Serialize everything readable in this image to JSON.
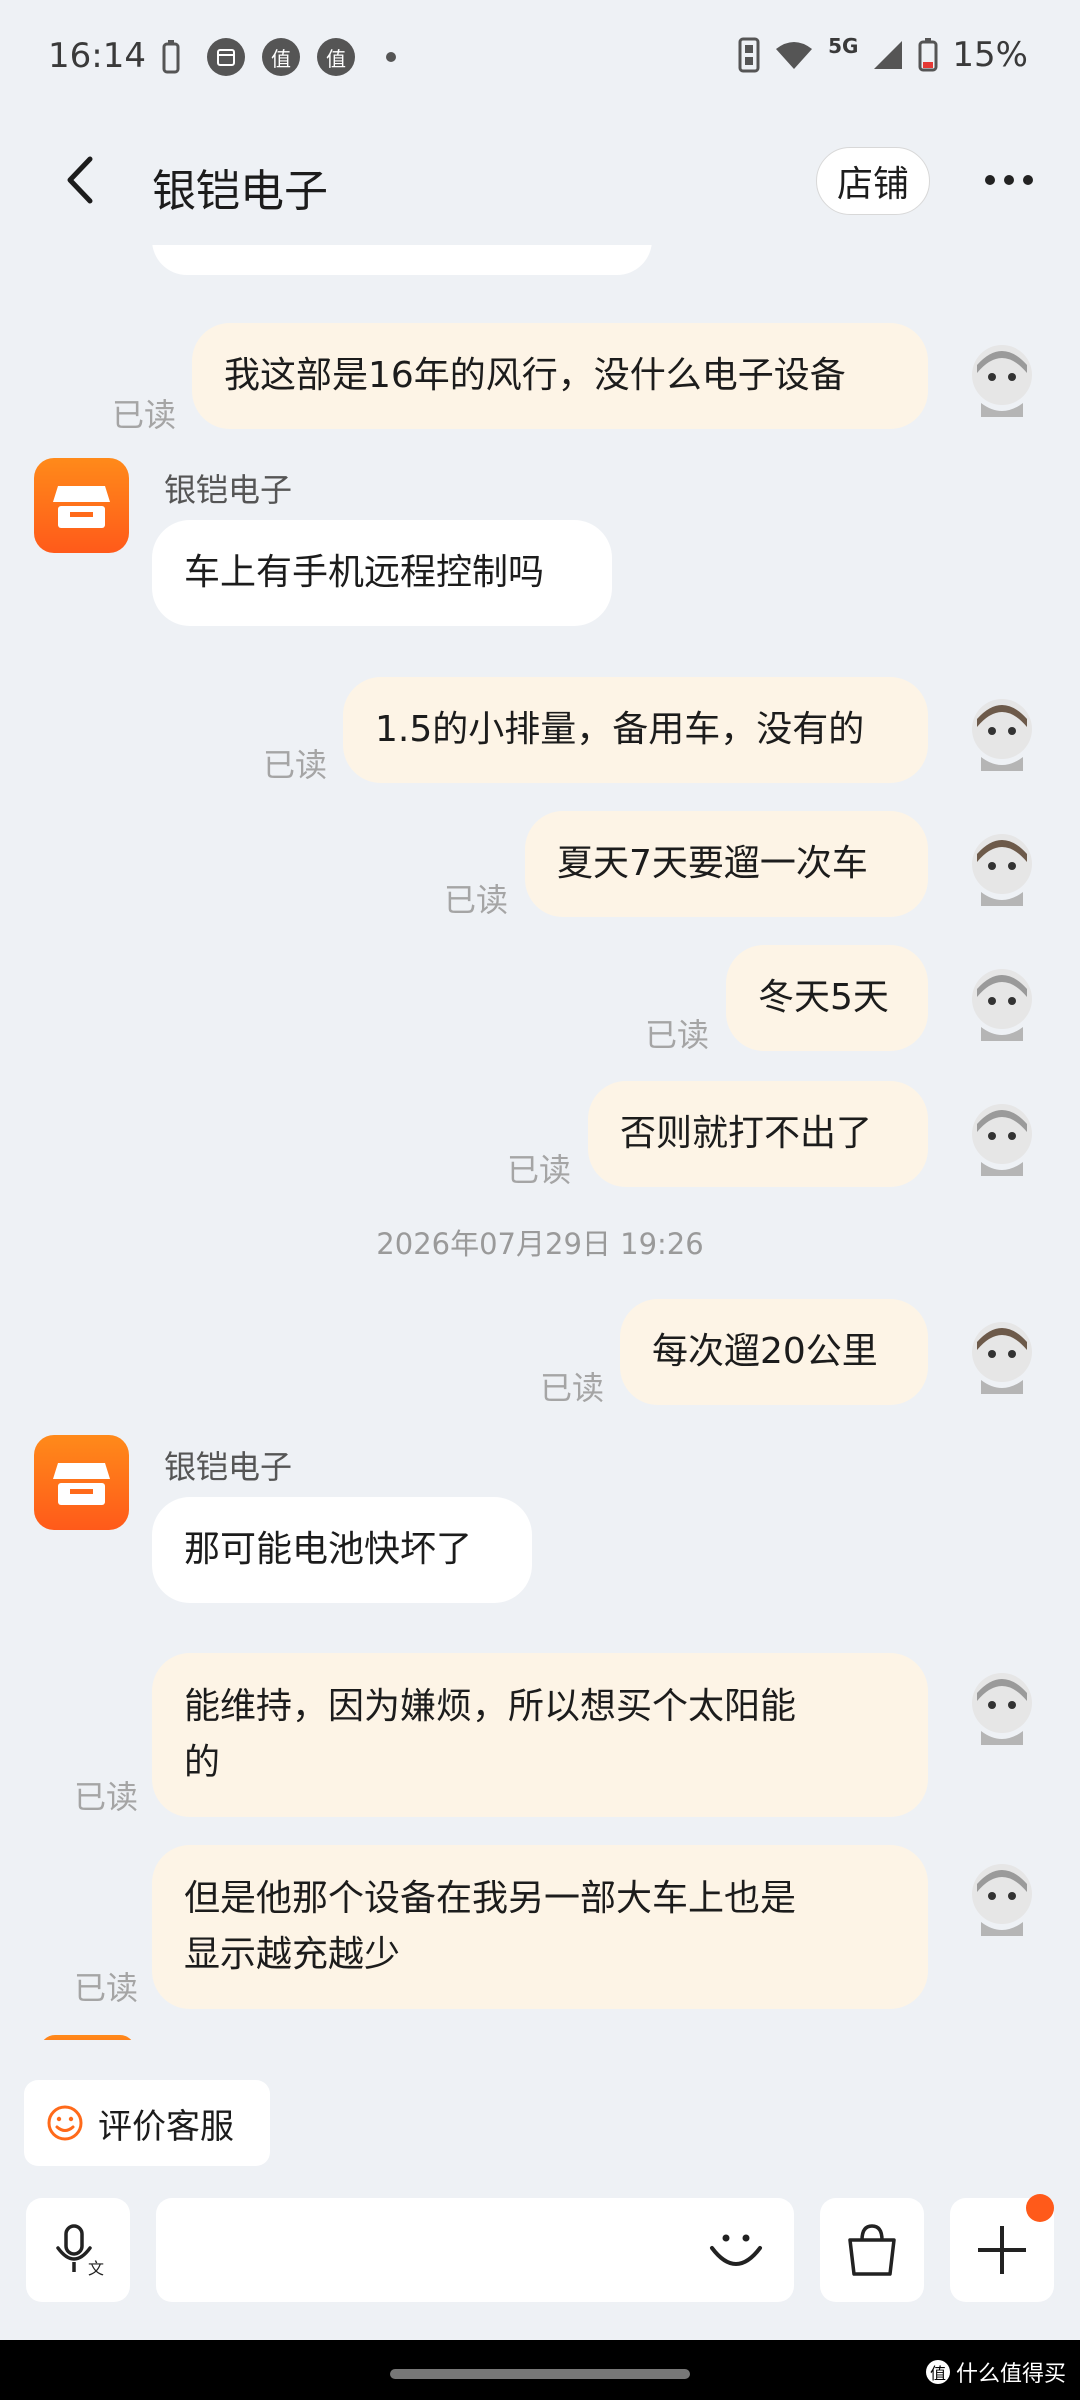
{
  "status": {
    "time": "16:14",
    "network": "5G",
    "battery": "15%",
    "icons": [
      "battery-saver-icon",
      "calendar-icon",
      "zhi-app-icon",
      "zhi-app-icon",
      "dot-icon"
    ]
  },
  "header": {
    "title": "银铠电子",
    "shop_label": "店铺"
  },
  "messages": {
    "m1": "我这部是16年的风行，没什么电子设备",
    "sender1": "银铠电子",
    "m2": "车上有手机远程控制吗",
    "m3": "1.5的小排量，备用车，没有的",
    "m4": "夏天7天要遛一次车",
    "m5": "冬天5天",
    "m6": "否则就打不出了",
    "timestamp": "2026年07月29日 19:26",
    "m7": "每次遛20公里",
    "sender2": "银铠电子",
    "m8": "那可能电池快坏了",
    "m9_line1": "能维持，因为嫌烦，所以想买个太阳能",
    "m9_line2": "的",
    "m10_line1": "但是他那个设备在我另一部大车上也是",
    "m10_line2": "显示越充越少",
    "read": "已读"
  },
  "footer": {
    "eval_label": "评价客服",
    "watermark": "什么值得买"
  },
  "colors": {
    "accent": "#ff6a1a",
    "out_bubble": "#fdf4e6",
    "in_bubble": "#ffffff",
    "background": "#eef1f5"
  }
}
